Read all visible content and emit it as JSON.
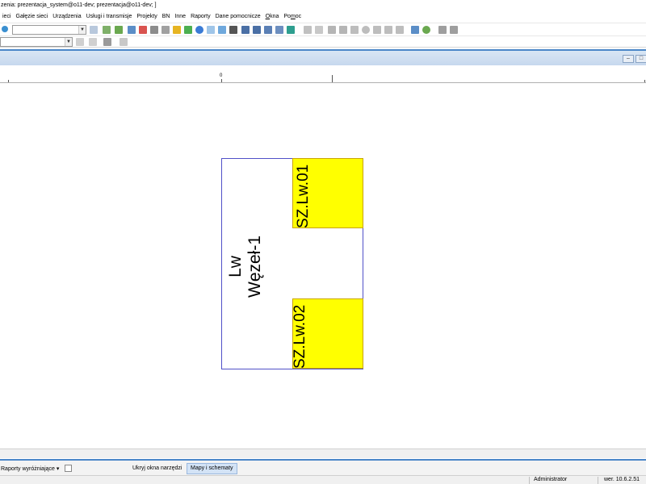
{
  "window": {
    "title": "zenia: prezentacja_system@o11-dev; prezentacja@o11-dev; ]"
  },
  "menubar": {
    "items": [
      {
        "label": "ieci"
      },
      {
        "label": "Gałęzie sieci"
      },
      {
        "label": "Urządzenia"
      },
      {
        "label": "Usługi i transmisje"
      },
      {
        "label": "Projekty"
      },
      {
        "label": "BN"
      },
      {
        "label": "Inne"
      },
      {
        "label": "Raporty"
      },
      {
        "label": "Dane pomocnicze"
      },
      {
        "label": "Okna"
      },
      {
        "label": "Pomoc"
      }
    ]
  },
  "toolbar": {
    "combo1_value": "",
    "combo2_value": ""
  },
  "ruler": {
    "origin_label": "0"
  },
  "diagram": {
    "node_name": "Węzeł-1",
    "node_code": "Lw",
    "slots": [
      {
        "label": "SZ.Lw.01"
      },
      {
        "label": "SZ.Lw.02"
      }
    ],
    "colors": {
      "slot_fill": "#ffff00",
      "node_border": "#5050c8"
    }
  },
  "bottom_panel": {
    "reports_label": "Raporty wyróżniające ▾",
    "hide_tools_label": "Ukryj okna narzędzi",
    "maps_tab_label": "Mapy i schematy"
  },
  "statusbar": {
    "user": "Administrator",
    "version": "wer. 10.6.2.51"
  }
}
